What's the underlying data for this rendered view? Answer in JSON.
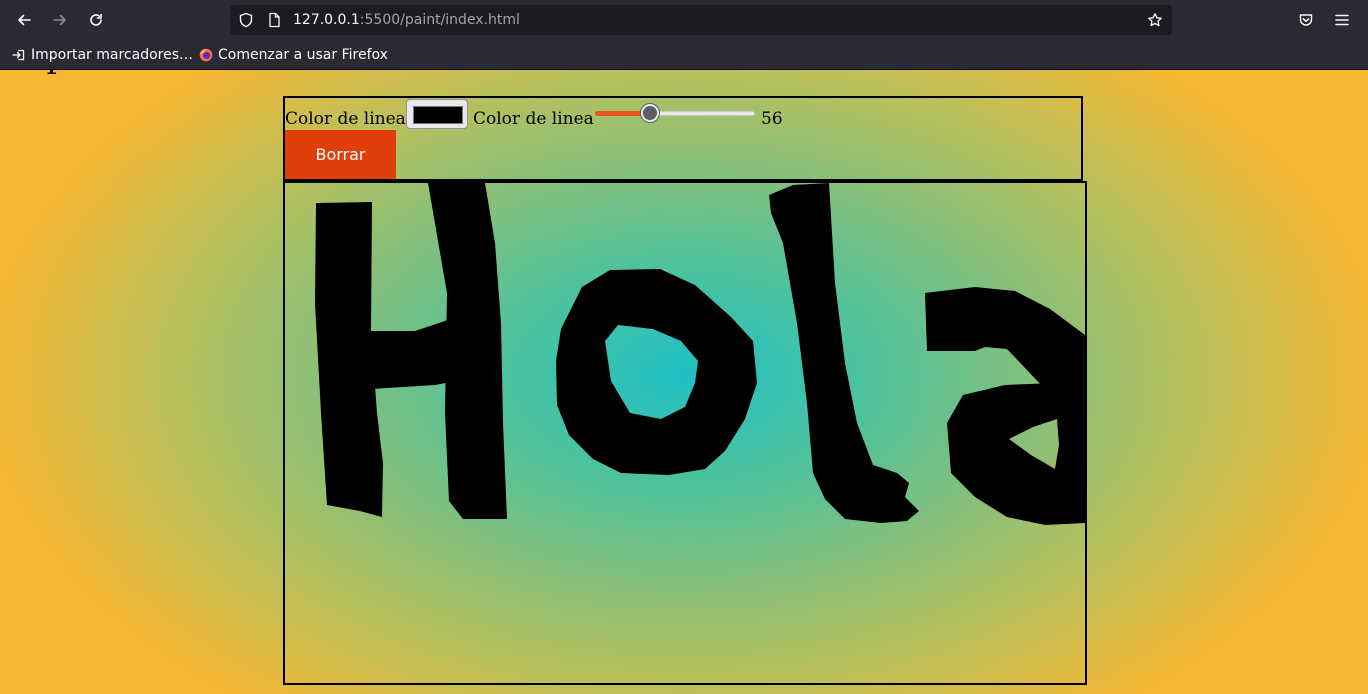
{
  "browser": {
    "url_host": "127.0.0.1",
    "url_rest": ":5500/paint/index.html",
    "icons": {
      "back": "back-arrow-icon",
      "forward": "forward-arrow-icon",
      "reload": "reload-icon",
      "site_info": "shield-icon",
      "page": "page-icon",
      "bookmark": "star-icon",
      "pocket": "pocket-icon",
      "menu": "hamburger-menu-icon"
    },
    "bookmarks": [
      {
        "label": "Importar marcadores…",
        "icon": "import-icon"
      },
      {
        "label": "Comenzar a usar Firefox",
        "icon": "firefox-icon"
      }
    ]
  },
  "page": {
    "stray_heading": "P",
    "controls": {
      "color_label": "Color de linea",
      "color_value": "#000000",
      "width_label": "Color de linea",
      "width_value": 56,
      "width_min": 1,
      "width_max": 160,
      "clear_label": "Borrar"
    },
    "canvas": {
      "stroke_color": "#000000",
      "drawn_text": "Hola"
    }
  },
  "colors": {
    "accent": "#e13f0a",
    "gradient_center": "#1fc0c5",
    "gradient_edge": "#f7b733",
    "chrome_bg": "#2b2a33",
    "urlbar_bg": "#1c1b22"
  }
}
